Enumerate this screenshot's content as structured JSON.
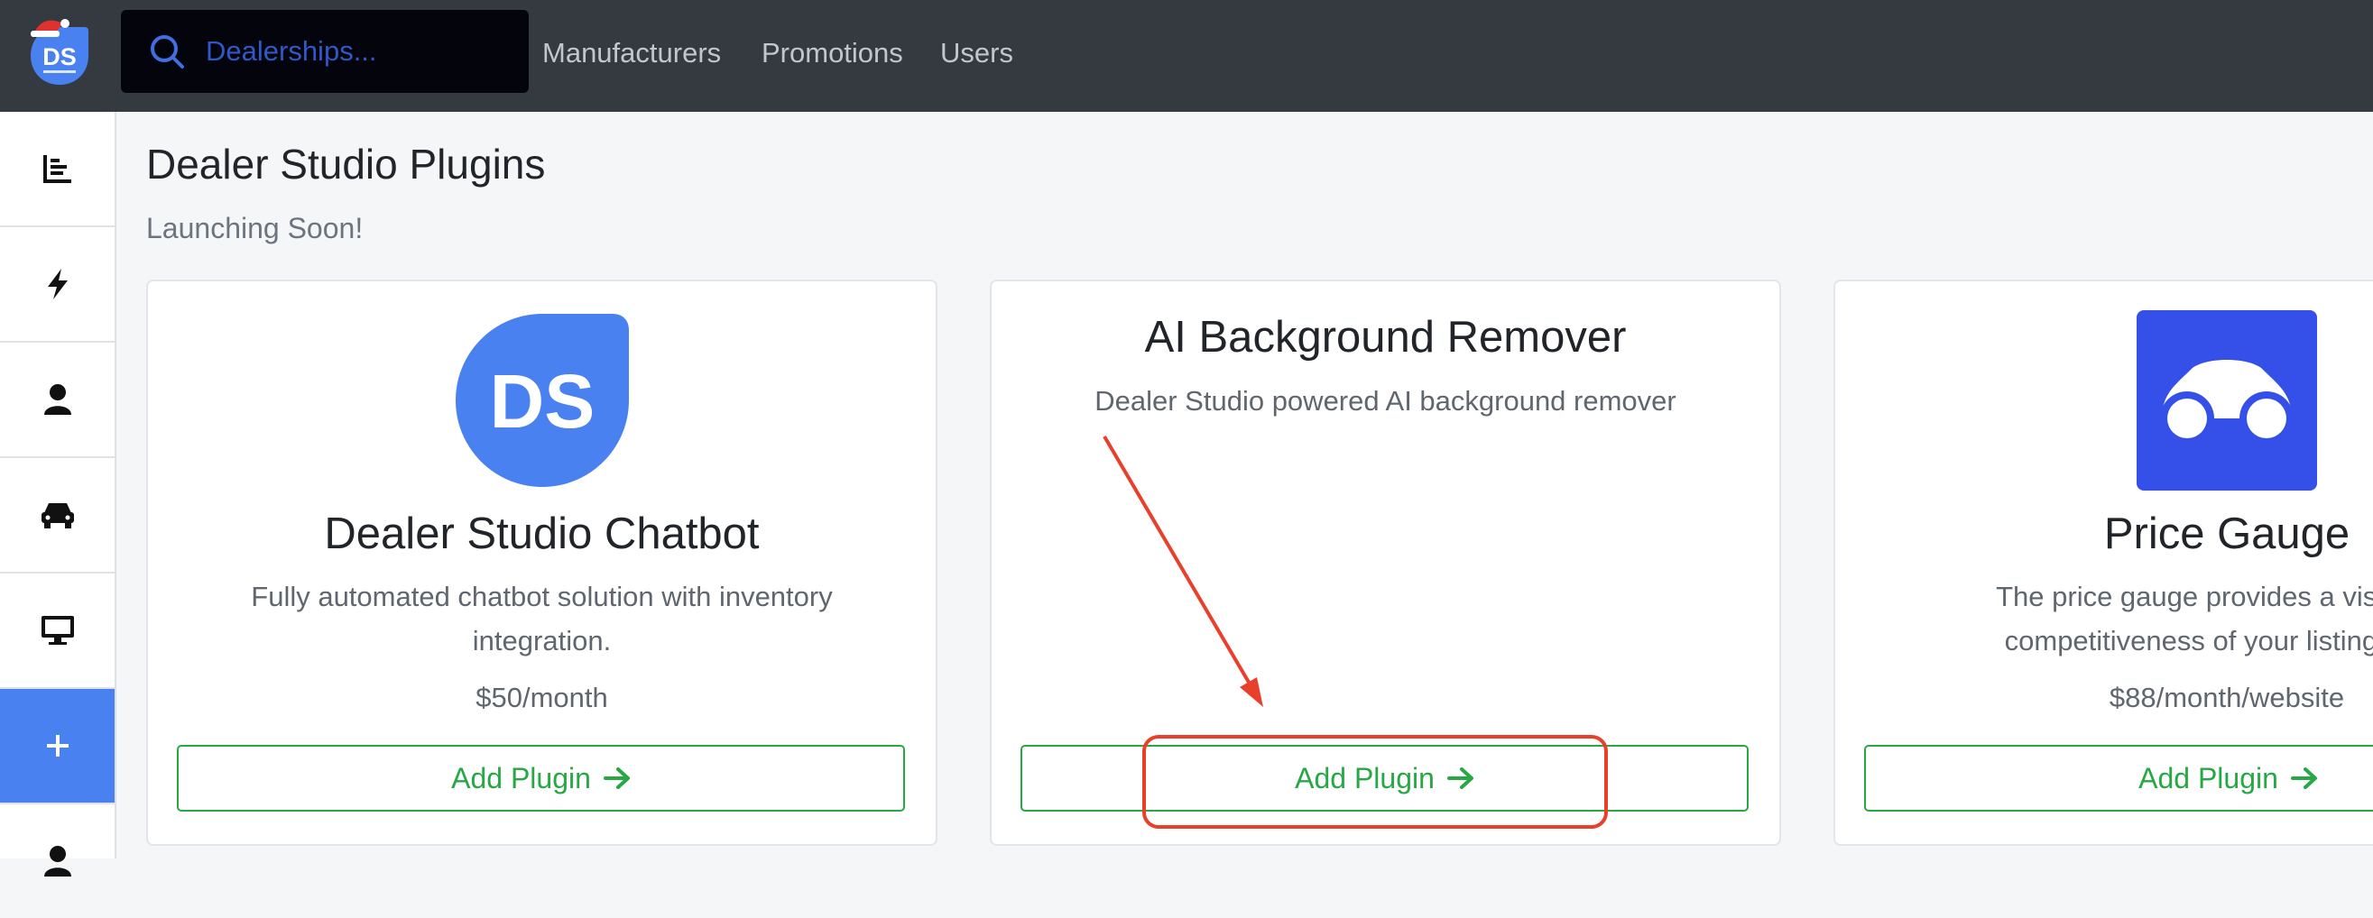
{
  "colors": {
    "topbar": "#343a40",
    "accent": "#4a81f1",
    "success": "#28a745",
    "annotation": "#e8402a"
  },
  "header": {
    "logo_text": "DS",
    "search": {
      "placeholder": "Dealerships..."
    },
    "nav": [
      "Manufacturers",
      "Promotions",
      "Users"
    ]
  },
  "sidebar": {
    "items": [
      {
        "icon": "bar-chart-icon"
      },
      {
        "icon": "lightning-icon"
      },
      {
        "icon": "user-icon"
      },
      {
        "icon": "car-icon"
      },
      {
        "icon": "monitor-icon"
      },
      {
        "icon": "plus-icon",
        "active": true
      },
      {
        "icon": "user-icon"
      }
    ]
  },
  "page": {
    "title": "Dealer Studio Plugins",
    "subtitle": "Launching Soon!"
  },
  "cards": [
    {
      "title": "Dealer Studio Chatbot",
      "logo_text": "DS",
      "desc_line1": "Fully automated chatbot solution with inventory",
      "desc_line2": "integration.",
      "price": "$50/month",
      "button": "Add Plugin"
    },
    {
      "title": "AI Background Remover",
      "desc_line1": "Dealer Studio powered AI background remover",
      "button": "Add Plugin"
    },
    {
      "title": "Price Gauge",
      "desc_line1": "The price gauge provides a visual inc",
      "desc_line2": "competitiveness of your listings. Em",
      "price": "$88/month/website",
      "button": "Add Plugin"
    }
  ]
}
